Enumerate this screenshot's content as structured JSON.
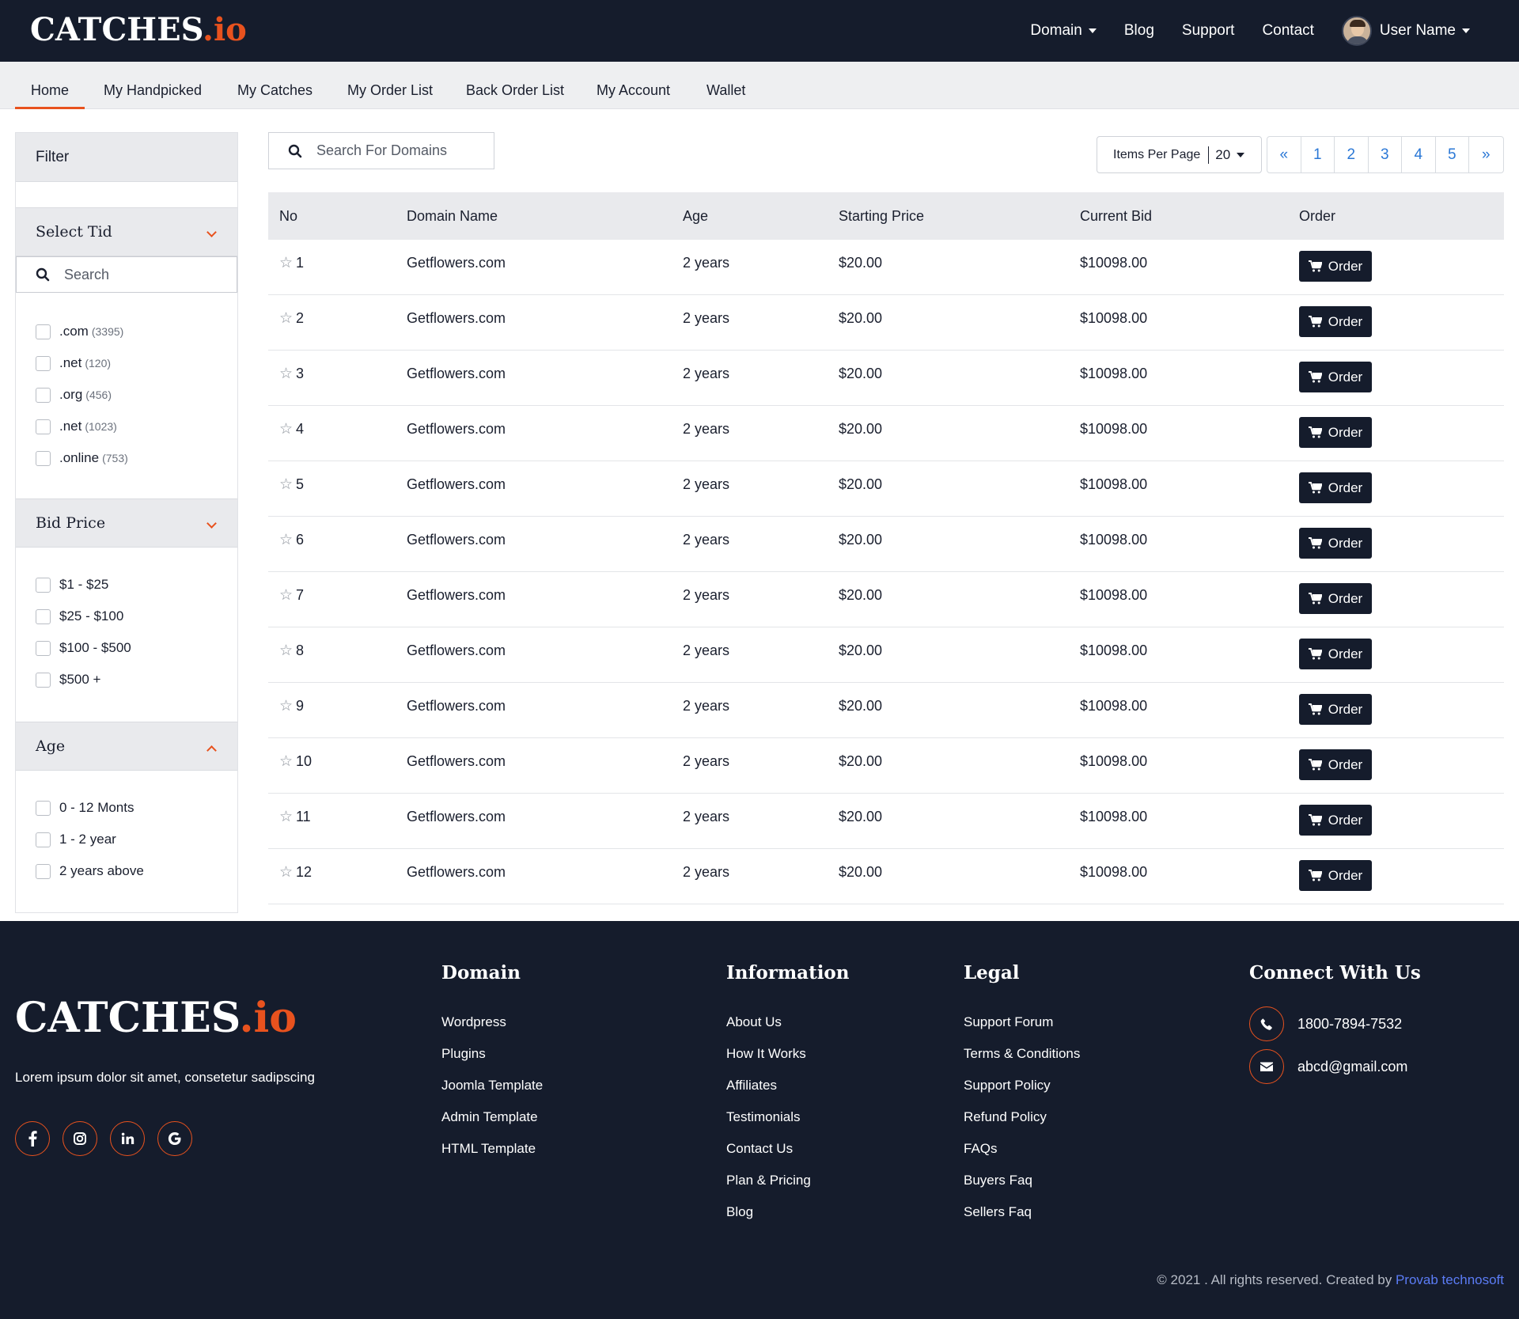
{
  "brand": {
    "name": "CATCHES",
    "tld": ".io"
  },
  "topnav": {
    "domain": "Domain",
    "blog": "Blog",
    "support": "Support",
    "contact": "Contact",
    "user": "User Name"
  },
  "tabs": [
    "Home",
    "My Handpicked",
    "My Catches",
    "My Order List",
    "Back Order List",
    "My Account",
    "Wallet"
  ],
  "sidebar": {
    "filter_title": "Filter",
    "tld_section": "Select Tid",
    "search_placeholder": "Search",
    "tlds": [
      {
        "label": ".com",
        "count": "(3395)"
      },
      {
        "label": ".net",
        "count": "(120)"
      },
      {
        "label": ".org",
        "count": "(456)"
      },
      {
        "label": ".net",
        "count": "(1023)"
      },
      {
        "label": ".online",
        "count": "(753)"
      }
    ],
    "bid_section": "Bid Price",
    "bids": [
      "$1 - $25",
      "$25 - $100",
      "$100 - $500",
      "$500 +"
    ],
    "age_section": "Age",
    "ages": [
      "0 - 12 Monts",
      "1 - 2 year",
      "2 years above"
    ]
  },
  "search": {
    "placeholder": "Search For Domains"
  },
  "items_per_page": {
    "label": "Items Per Page",
    "value": "20"
  },
  "pagination": [
    "«",
    "1",
    "2",
    "3",
    "4",
    "5",
    "»"
  ],
  "table": {
    "headers": [
      "No",
      "Domain Name",
      "Age",
      "Starting Price",
      "Current Bid",
      "Order"
    ],
    "order_label": "Order",
    "rows": [
      {
        "no": "1",
        "domain": "Getflowers.com",
        "age": "2 years",
        "start": "$20.00",
        "bid": "$10098.00"
      },
      {
        "no": "2",
        "domain": "Getflowers.com",
        "age": "2 years",
        "start": "$20.00",
        "bid": "$10098.00"
      },
      {
        "no": "3",
        "domain": "Getflowers.com",
        "age": "2 years",
        "start": "$20.00",
        "bid": "$10098.00"
      },
      {
        "no": "4",
        "domain": "Getflowers.com",
        "age": "2 years",
        "start": "$20.00",
        "bid": "$10098.00"
      },
      {
        "no": "5",
        "domain": "Getflowers.com",
        "age": "2 years",
        "start": "$20.00",
        "bid": "$10098.00"
      },
      {
        "no": "6",
        "domain": "Getflowers.com",
        "age": "2 years",
        "start": "$20.00",
        "bid": "$10098.00"
      },
      {
        "no": "7",
        "domain": "Getflowers.com",
        "age": "2 years",
        "start": "$20.00",
        "bid": "$10098.00"
      },
      {
        "no": "8",
        "domain": "Getflowers.com",
        "age": "2 years",
        "start": "$20.00",
        "bid": "$10098.00"
      },
      {
        "no": "9",
        "domain": "Getflowers.com",
        "age": "2 years",
        "start": "$20.00",
        "bid": "$10098.00"
      },
      {
        "no": "10",
        "domain": "Getflowers.com",
        "age": "2 years",
        "start": "$20.00",
        "bid": "$10098.00"
      },
      {
        "no": "11",
        "domain": "Getflowers.com",
        "age": "2 years",
        "start": "$20.00",
        "bid": "$10098.00"
      },
      {
        "no": "12",
        "domain": "Getflowers.com",
        "age": "2 years",
        "start": "$20.00",
        "bid": "$10098.00"
      }
    ]
  },
  "footer": {
    "tagline": "Lorem ipsum dolor sit amet, consetetur sadipscing",
    "socials": [
      "facebook-icon",
      "instagram-icon",
      "linkedin-icon",
      "google-icon"
    ],
    "domain_title": "Domain",
    "domain_links": [
      "Wordpress",
      "Plugins",
      "Joomla Template",
      "Admin Template",
      "HTML Template"
    ],
    "info_title": "Information",
    "info_links": [
      "About Us",
      "How It Works",
      "Affiliates",
      "Testimonials",
      "Contact Us",
      "Plan & Pricing",
      "Blog"
    ],
    "legal_title": "Legal",
    "legal_links": [
      "Support Forum",
      "Terms & Conditions",
      "Support Policy",
      "Refund Policy",
      "FAQs",
      "Buyers Faq",
      "Sellers Faq"
    ],
    "connect_title": "Connect With Us",
    "phone": "1800-7894-7532",
    "email": "abcd@gmail.com",
    "copyright": "© 2021 . All rights reserved. Created by",
    "credit": "Provab technosoft"
  },
  "colors": {
    "navy": "#151c2c",
    "accent": "#e8521e",
    "link_blue": "#2b78d6"
  }
}
